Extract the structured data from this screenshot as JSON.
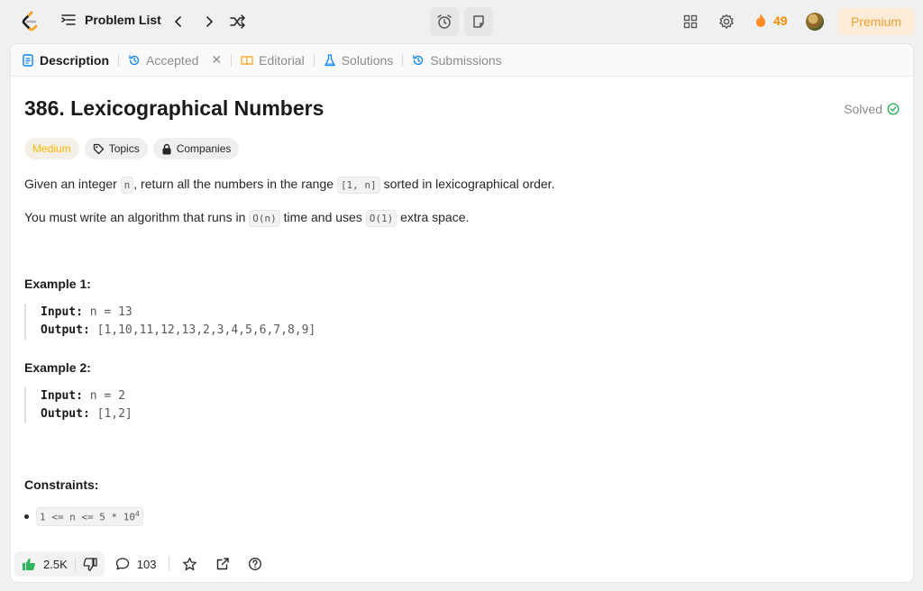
{
  "topbar": {
    "problem_list_label": "Problem List",
    "streak_count": "49",
    "premium_label": "Premium"
  },
  "tabs": {
    "description": "Description",
    "accepted": "Accepted",
    "editorial": "Editorial",
    "solutions": "Solutions",
    "submissions": "Submissions"
  },
  "problem": {
    "title": "386. Lexicographical Numbers",
    "status": "Solved",
    "difficulty": "Medium",
    "topics_label": "Topics",
    "companies_label": "Companies",
    "desc1": {
      "t1": "Given an integer ",
      "c1": "n",
      "t2": ", return all the numbers in the range ",
      "c2": "[1, n]",
      "t3": " sorted in lexicographical order."
    },
    "desc2": {
      "t1": "You must write an algorithm that runs in ",
      "c1": "O(n)",
      "t2": " time and uses ",
      "c2": "O(1)",
      "t3": " extra space."
    },
    "example1": {
      "heading": "Example 1:",
      "input_label": "Input:",
      "input_value": "n = 13",
      "output_label": "Output:",
      "output_value": "[1,10,11,12,13,2,3,4,5,6,7,8,9]"
    },
    "example2": {
      "heading": "Example 2:",
      "input_label": "Input:",
      "input_value": "n = 2",
      "output_label": "Output:",
      "output_value": "[1,2]"
    },
    "constraints": {
      "heading": "Constraints:",
      "item_prefix": "1 <= n <= 5 * 10",
      "item_exponent": "4"
    }
  },
  "bottom": {
    "likes": "2.5K",
    "comments": "103"
  },
  "colors": {
    "accent_orange": "#ffa116",
    "medium": "#ffb800",
    "solved_green": "#2db55d",
    "like_green": "#2db55d"
  },
  "icons": [
    "logo-icon",
    "list-icon",
    "chevron-left-icon",
    "chevron-right-icon",
    "shuffle-icon",
    "alarm-icon",
    "note-icon",
    "layout-icon",
    "gear-icon",
    "fire-icon",
    "description-icon",
    "history-icon",
    "close-icon",
    "book-icon",
    "flask-icon",
    "tag-icon",
    "lock-icon",
    "check-circle-icon",
    "thumbs-up-icon",
    "thumbs-down-icon",
    "comment-icon",
    "star-icon",
    "share-icon",
    "help-icon"
  ]
}
